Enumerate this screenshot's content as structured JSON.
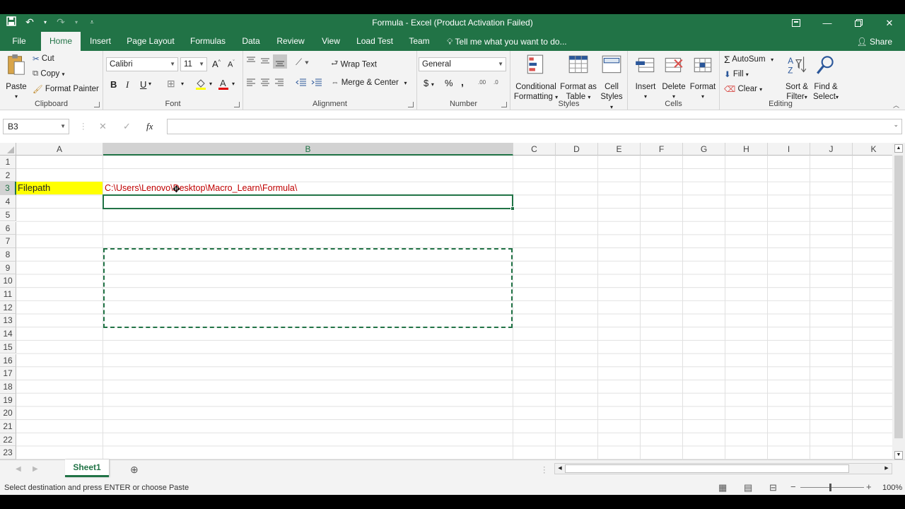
{
  "window": {
    "title": "Formula - Excel (Product Activation Failed)"
  },
  "tabs": [
    {
      "label": "File"
    },
    {
      "label": "Home"
    },
    {
      "label": "Insert"
    },
    {
      "label": "Page Layout"
    },
    {
      "label": "Formulas"
    },
    {
      "label": "Data"
    },
    {
      "label": "Review"
    },
    {
      "label": "View"
    },
    {
      "label": "Load Test"
    },
    {
      "label": "Team"
    }
  ],
  "tell_me": "Tell me what you want to do...",
  "share": "Share",
  "clipboard": {
    "paste": "Paste",
    "cut": "Cut",
    "copy": "Copy",
    "format_painter": "Format Painter",
    "label": "Clipboard"
  },
  "font": {
    "name": "Calibri",
    "size": "11",
    "bold": "B",
    "italic": "I",
    "underline": "U",
    "label": "Font"
  },
  "alignment": {
    "wrap": "Wrap Text",
    "merge": "Merge & Center",
    "label": "Alignment"
  },
  "number": {
    "format": "General",
    "currency": "$",
    "percent": "%",
    "comma": ",",
    "inc": ".00",
    "dec": ".0",
    "label": "Number"
  },
  "styles": {
    "conditional": "Conditional",
    "conditional2": "Formatting",
    "format_table": "Format as",
    "format_table2": "Table",
    "cell_styles": "Cell",
    "cell_styles2": "Styles",
    "label": "Styles"
  },
  "cells_group": {
    "insert": "Insert",
    "delete": "Delete",
    "format": "Format",
    "label": "Cells"
  },
  "editing": {
    "autosum": "AutoSum",
    "fill": "Fill",
    "clear": "Clear",
    "sort": "Sort &",
    "sort2": "Filter",
    "find": "Find &",
    "find2": "Select",
    "label": "Editing"
  },
  "formula_bar": {
    "name_box": "B3",
    "fx": "fx",
    "formula": ""
  },
  "columns": [
    "A",
    "B",
    "C",
    "D",
    "E",
    "F",
    "G",
    "H",
    "I",
    "J",
    "K"
  ],
  "rows": [
    "1",
    "2",
    "3",
    "4",
    "5",
    "6",
    "7",
    "8",
    "9",
    "10",
    "11",
    "12",
    "13",
    "14",
    "15",
    "16",
    "17",
    "18",
    "19",
    "20",
    "21",
    "22",
    "23"
  ],
  "sheet": {
    "a2": "Filepath",
    "b2": "C:\\Users\\Lenovo\\Desktop\\Macro_Learn\\Formula\\"
  },
  "sheet_tabs": [
    {
      "label": "Sheet1"
    }
  ],
  "status": {
    "message": "Select destination and press ENTER or choose Paste",
    "zoom": "100%"
  },
  "colors": {
    "excel_green": "#217346",
    "highlight": "#ffff00",
    "path_text": "#c00000"
  }
}
